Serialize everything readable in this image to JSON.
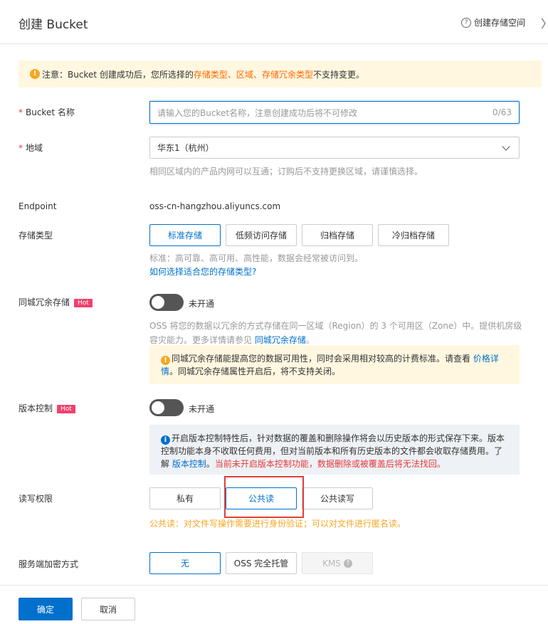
{
  "header": {
    "title": "创建 Bucket",
    "help_link": "创建存储空间",
    "help_icon_glyph": "?",
    "close_glyph": "〉"
  },
  "notice": {
    "prefix": "注意：Bucket 创建成功后，您所选择的 ",
    "link1": "存储类型",
    "sep1": "、",
    "link2": "区域",
    "sep2": "、",
    "link3": "存储冗余类型",
    "suffix": " 不支持变更。"
  },
  "bucket_name": {
    "label": "Bucket 名称",
    "required_mark": "*",
    "placeholder": "请输入您的Bucket名称，注意创建成功后将不可修改",
    "count": "0/63"
  },
  "region": {
    "label": "地域",
    "required_mark": "*",
    "value": "华东1（杭州）",
    "hint": "相同区域内的产品内网可以互通；订购后不支持更换区域，请谨慎选择。"
  },
  "endpoint": {
    "label": "Endpoint",
    "value": "oss-cn-hangzhou.aliyuncs.com"
  },
  "storage_class": {
    "label": "存储类型",
    "options": [
      "标准存储",
      "低频访问存储",
      "归档存储",
      "冷归档存储"
    ],
    "selected": "标准存储",
    "hint": "标准：高可靠、高可用、高性能，数据会经常被访问到。",
    "link": "如何选择适合您的存储类型?"
  },
  "zrs": {
    "label": "同城冗余存储",
    "badge": "Hot",
    "toggle_label": "未开通",
    "hint_prefix": "OSS 将您的数据以冗余的方式存储在同一区域（Region）的 3 个可用区（Zone）中。提供机房级容灾能力。更多详情请参见 ",
    "hint_link": "同城冗余存储",
    "hint_suffix": "。",
    "warn_prefix": "同城冗余存储能提高您的数据可用性，同时会采用相对较高的计费标准。请查看 ",
    "warn_link": "价格详情",
    "warn_suffix": "。同城冗余存储属性开启后，将不支持关闭。"
  },
  "versioning": {
    "label": "版本控制",
    "badge": "Hot",
    "toggle_label": "未开通",
    "info_text": "开启版本控制特性后，针对数据的覆盖和删除操作将会以历史版本的形式保存下来。版本控制功能本身不收取任何费用，但对当前版本和所有历史版本的文件都会收取存储费用。了解 ",
    "info_link": "版本控制",
    "info_sep": "。",
    "info_warn": "当前未开启版本控制功能，数据删除或被覆盖后将无法找回。"
  },
  "acl": {
    "label": "读写权限",
    "options": [
      "私有",
      "公共读",
      "公共读写"
    ],
    "selected": "公共读",
    "note": "公共读：对文件写操作需要进行身份验证；可以对文件进行匿名读。"
  },
  "encryption": {
    "label": "服务端加密方式",
    "options": [
      "无",
      "OSS 完全托管",
      "KMS"
    ],
    "selected": "无",
    "help_glyph": "?"
  },
  "footer": {
    "confirm": "确定",
    "cancel": "取消"
  },
  "icon_glyphs": {
    "warning": "!",
    "info": "i"
  },
  "colors": {
    "accent": "#0070cc",
    "warning_bg": "#fff7e0",
    "info_bg": "#eef1f5",
    "highlight": "#e03e3e",
    "hot": "#f1416c",
    "orange_link": "#ff6a00"
  }
}
